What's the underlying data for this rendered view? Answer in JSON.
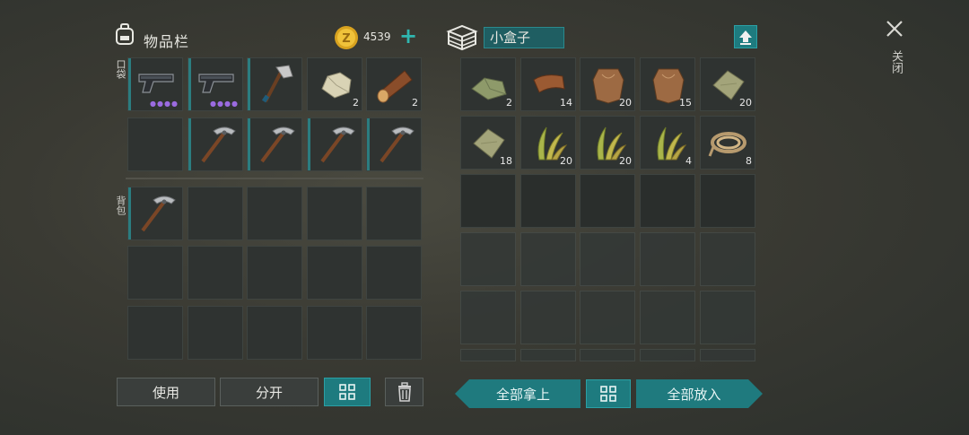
{
  "inventory": {
    "title": "物品栏",
    "currency": "4539",
    "pocket_label": "口袋",
    "backpack_label": "背包",
    "pocket_row1": [
      {
        "icon": "pistol-icon",
        "count": "",
        "dots": "●●●●"
      },
      {
        "icon": "pistol-icon",
        "count": "",
        "dots": "●●●●"
      },
      {
        "icon": "hatchet-icon",
        "count": "",
        "dots": ""
      },
      {
        "icon": "stone-icon",
        "count": "2",
        "dots": ""
      },
      {
        "icon": "log-icon",
        "count": "2",
        "dots": ""
      }
    ],
    "pocket_row2": [
      {
        "icon": "",
        "count": ""
      },
      {
        "icon": "pickaxe-icon",
        "count": ""
      },
      {
        "icon": "pickaxe-icon",
        "count": ""
      },
      {
        "icon": "pickaxe-icon",
        "count": ""
      },
      {
        "icon": "pickaxe-icon",
        "count": ""
      }
    ],
    "backpack_first": {
      "icon": "pickaxe-icon",
      "count": ""
    }
  },
  "container": {
    "title": "小盒子",
    "row1": [
      {
        "icon": "cloth-icon",
        "count": "2"
      },
      {
        "icon": "leather-icon",
        "count": "14"
      },
      {
        "icon": "hide-icon",
        "count": "20"
      },
      {
        "icon": "hide-icon",
        "count": "15"
      },
      {
        "icon": "fabric-icon",
        "count": "20"
      }
    ],
    "row2": [
      {
        "icon": "fabric-icon",
        "count": "18"
      },
      {
        "icon": "plant-fiber-icon",
        "count": "20"
      },
      {
        "icon": "plant-fiber-icon",
        "count": "20"
      },
      {
        "icon": "plant-fiber-icon",
        "count": "4"
      },
      {
        "icon": "rope-icon",
        "count": "8"
      }
    ]
  },
  "buttons": {
    "use": "使用",
    "split": "分开",
    "take_all": "全部拿上",
    "put_all": "全部放入",
    "close": "关闭"
  },
  "colors": {
    "accent": "#1f7a7e",
    "durability": "#2b7d80",
    "rarity": "#9b6be0"
  }
}
